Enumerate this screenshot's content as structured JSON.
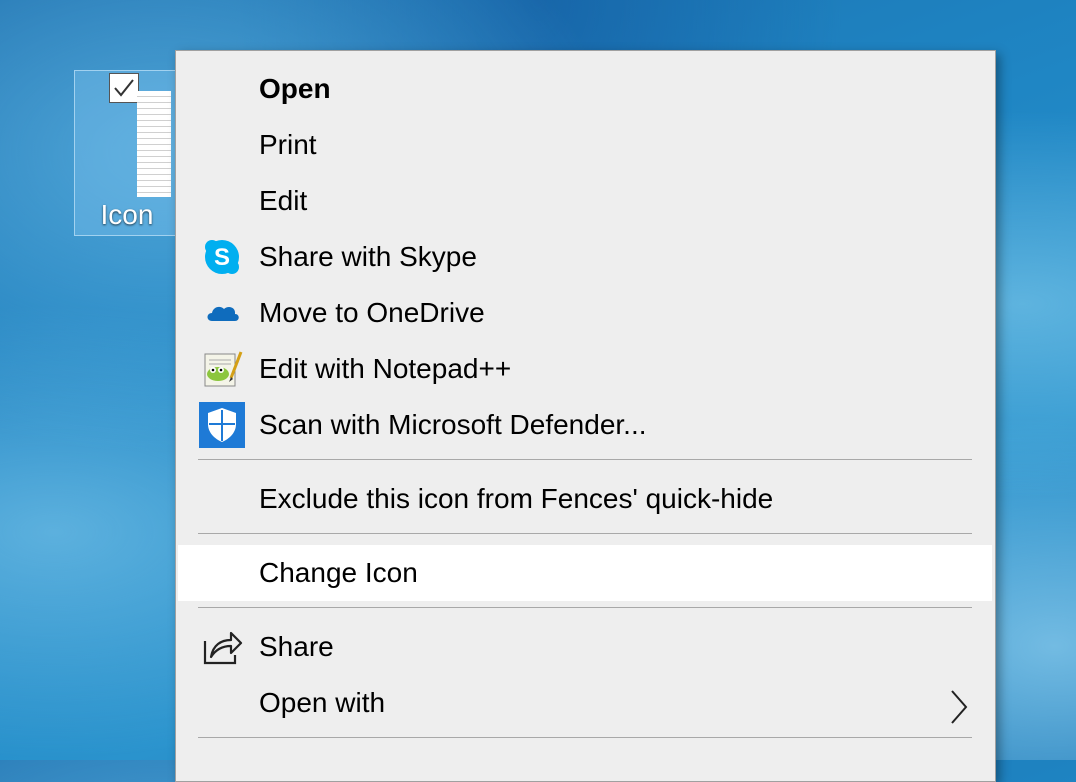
{
  "desktop": {
    "icon_label": "Icon",
    "icon_checked": true
  },
  "context_menu": {
    "items": [
      {
        "label": "Open",
        "bold": true
      },
      {
        "label": "Print"
      },
      {
        "label": "Edit"
      },
      {
        "label": "Share with Skype",
        "icon": "skype-icon"
      },
      {
        "label": "Move to OneDrive",
        "icon": "onedrive-icon"
      },
      {
        "label": "Edit with Notepad++",
        "icon": "notepadpp-icon"
      },
      {
        "label": "Scan with Microsoft Defender...",
        "icon": "defender-shield-icon"
      },
      {
        "label": "Exclude this icon from Fences' quick-hide"
      },
      {
        "label": "Change Icon",
        "highlighted": true
      },
      {
        "label": "Share",
        "icon": "share-icon"
      },
      {
        "label": "Open with",
        "submenu": true
      }
    ]
  },
  "colors": {
    "skype_blue": "#00aff0",
    "onedrive_blue": "#0f6cbd",
    "defender_blue": "#1e7ad6",
    "menu_bg": "#eeeeee",
    "menu_hover": "#ffffff"
  }
}
